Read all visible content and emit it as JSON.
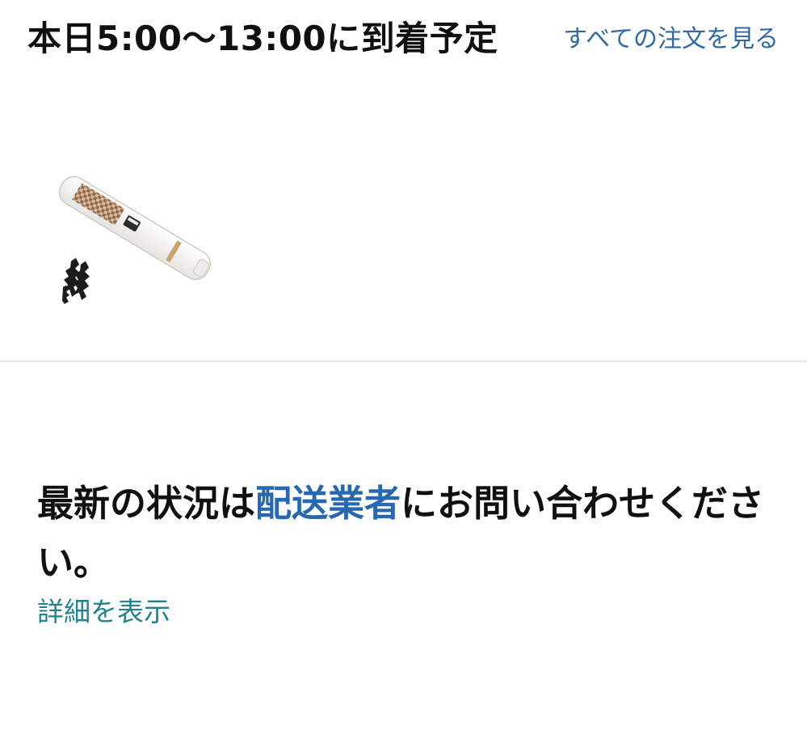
{
  "header": {
    "delivery_title": "本日5:00〜13:00に到着予定",
    "all_orders_link": "すべての注文を見る"
  },
  "product": {
    "image_icon": "hair-straightener-product-image"
  },
  "status": {
    "message_prefix": "最新の状況は",
    "carrier_link": "配送業者",
    "message_suffix": "にお問い合わせください。",
    "details_link": "詳細を表示"
  },
  "colors": {
    "text_primary": "#0f1111",
    "link_blue": "#2f6aa3",
    "carrier_blue": "#2868b1",
    "details_teal": "#1f8391",
    "divider": "#e3e6e6"
  }
}
